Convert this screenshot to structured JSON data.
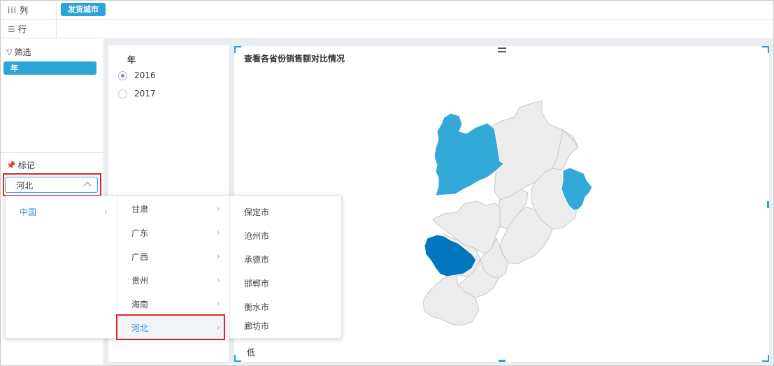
{
  "shelves": {
    "column": {
      "label": "列",
      "icon": "columns-icon",
      "pill": "发货城市"
    },
    "row": {
      "label": "行",
      "icon": "rows-icon"
    }
  },
  "filter_section": {
    "title": "筛选",
    "icon": "filter-icon",
    "pill": "年"
  },
  "mark_section": {
    "title": "标记",
    "icon": "pin-icon",
    "select_value": "河北",
    "select_icon": "chevron-up-icon"
  },
  "year_filter": {
    "title": "年",
    "options": [
      {
        "label": "2016",
        "checked": true
      },
      {
        "label": "2017",
        "checked": false
      }
    ]
  },
  "chart": {
    "title": "查看各省份销售额对比情况",
    "legend_low": "低",
    "colors": {
      "dark": "#0277bd",
      "mid": "#33a9d8",
      "light": "#ececec",
      "border": "#c8c8c8"
    }
  },
  "cascader": {
    "level1": [
      {
        "label": "中国",
        "active": true
      }
    ],
    "level2": [
      {
        "label": "甘肃"
      },
      {
        "label": "广东"
      },
      {
        "label": "广西"
      },
      {
        "label": "贵州"
      },
      {
        "label": "海南"
      },
      {
        "label": "河北",
        "selected": true
      }
    ],
    "level3": [
      {
        "label": "保定市"
      },
      {
        "label": "沧州市"
      },
      {
        "label": "承德市"
      },
      {
        "label": "邯郸市"
      },
      {
        "label": "衡水市"
      },
      {
        "label": "廊坊市"
      }
    ]
  }
}
